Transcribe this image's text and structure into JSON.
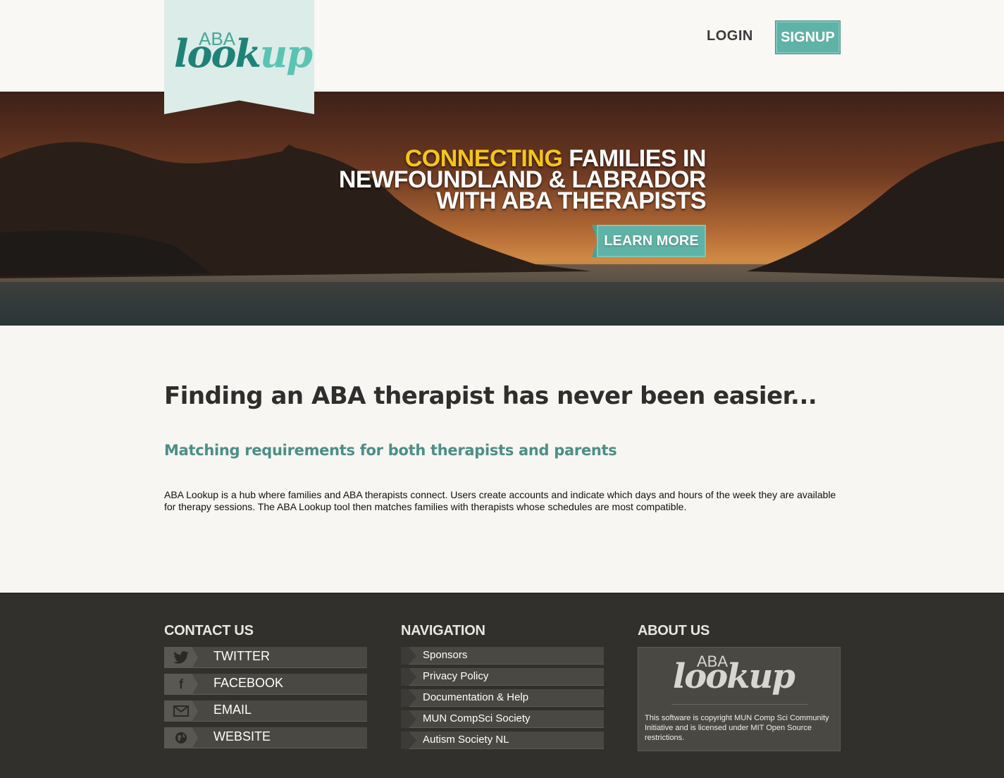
{
  "header": {
    "logo_aba": "ABA",
    "logo_look": "look",
    "logo_up": "up",
    "login_label": "LOGIN",
    "signup_label": "SIGNUP"
  },
  "hero": {
    "line1_highlight": "CONNECTING",
    "line1_rest": " FAMILIES IN",
    "line2": "NEWFOUNDLAND & LABRADOR",
    "line3": "WITH ABA THERAPISTS",
    "cta_label": "LEARN MORE",
    "colors": {
      "highlight": "#f5c518",
      "accent": "#5fb3a6"
    }
  },
  "main": {
    "title": "Finding an ABA therapist has never been easier...",
    "subtitle": "Matching requirements for both therapists and parents",
    "body": "ABA Lookup is a hub where families and ABA therapists connect. Users create accounts and indicate which days and hours of the week they are available for therapy sessions. The ABA Lookup tool then matches families with therapists whose schedules are most compatible."
  },
  "footer": {
    "contact": {
      "heading": "CONTACT US",
      "items": [
        {
          "label": "TWITTER",
          "icon": "twitter-icon"
        },
        {
          "label": "FACEBOOK",
          "icon": "facebook-icon"
        },
        {
          "label": "EMAIL",
          "icon": "envelope-icon"
        },
        {
          "label": "WEBSITE",
          "icon": "globe-icon"
        }
      ]
    },
    "navigation": {
      "heading": "NAVIGATION",
      "items": [
        {
          "label": "Sponsors"
        },
        {
          "label": "Privacy Policy"
        },
        {
          "label": "Documentation & Help"
        },
        {
          "label": "MUN CompSci Society"
        },
        {
          "label": "Autism Society NL"
        }
      ]
    },
    "about": {
      "heading": "ABOUT US",
      "logo_aba": "ABA",
      "logo_lookup": "lookup",
      "text": "This software is copyright MUN Comp Sci Community Initiative and is licensed under MIT Open Source restrictions."
    }
  }
}
